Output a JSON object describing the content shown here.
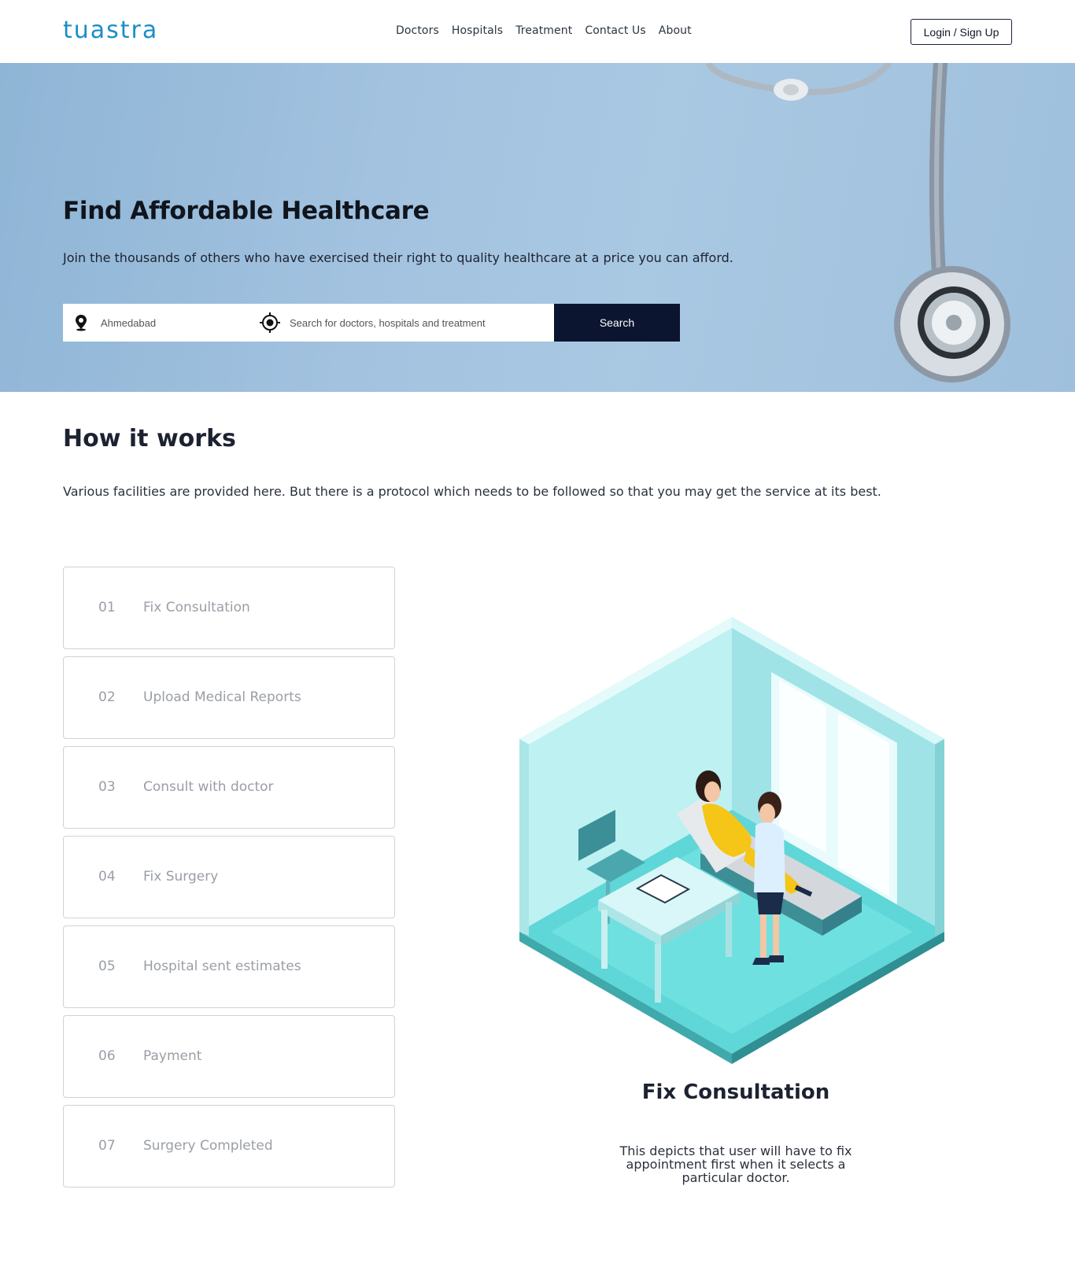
{
  "header": {
    "logo_text": "tuastra",
    "nav": [
      "Doctors",
      "Hospitals",
      "Treatment",
      "Contact Us",
      "About"
    ],
    "login_label": "Login / Sign Up"
  },
  "hero": {
    "title": "Find Affordable Healthcare",
    "subtitle": "Join the thousands of others who have exercised their right to quality healthcare at a price you can afford.",
    "location_placeholder": "Ahmedabad",
    "search_placeholder": "Search for doctors, hospitals and treatment",
    "search_label": "Search"
  },
  "how": {
    "title": "How it works",
    "description": "Various facilities are provided here. But there is a protocol which needs to be followed so that you may get the service at its best.",
    "steps": [
      {
        "num": "01",
        "label": "Fix Consultation"
      },
      {
        "num": "02",
        "label": "Upload Medical Reports"
      },
      {
        "num": "03",
        "label": "Consult with doctor"
      },
      {
        "num": "04",
        "label": "Fix Surgery"
      },
      {
        "num": "05",
        "label": "Hospital sent estimates"
      },
      {
        "num": "06",
        "label": "Payment"
      },
      {
        "num": "07",
        "label": "Surgery Completed"
      }
    ],
    "detail": {
      "title": "Fix Consultation",
      "description": "This depicts that user will have to fix appointment first when it selects a particular doctor."
    }
  },
  "colors": {
    "brand": "#1a8fc4",
    "search_button": "#0c1530",
    "hero_bg": "#a2c2df",
    "step_text": "#9a9ea6"
  }
}
